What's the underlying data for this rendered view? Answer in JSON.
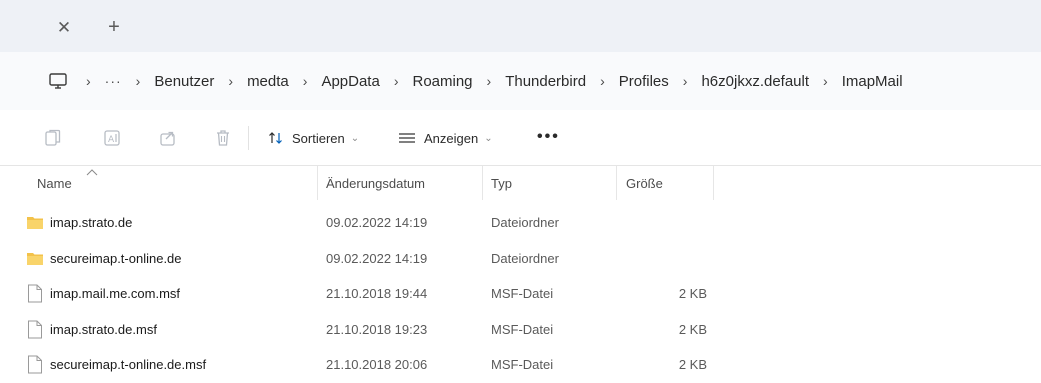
{
  "tabbar": {
    "close_glyph": "✕",
    "new_tab_glyph": "+"
  },
  "address": {
    "overflow": "···",
    "crumbs": [
      "Benutzer",
      "medta",
      "AppData",
      "Roaming",
      "Thunderbird",
      "Profiles",
      "h6z0jkxz.default",
      "ImapMail"
    ],
    "separator": "›"
  },
  "toolbar": {
    "sort_label": "Sortieren",
    "view_label": "Anzeigen",
    "more": "•••",
    "chevron": "⌄"
  },
  "columns": {
    "name": "Name",
    "date": "Änderungsdatum",
    "type": "Typ",
    "size": "Größe"
  },
  "files": [
    {
      "name": "imap.strato.de",
      "date": "09.02.2022 14:19",
      "type": "Dateiordner",
      "size": "",
      "icon": "folder-icon"
    },
    {
      "name": "secureimap.t-online.de",
      "date": "09.02.2022 14:19",
      "type": "Dateiordner",
      "size": "",
      "icon": "folder-icon"
    },
    {
      "name": "imap.mail.me.com.msf",
      "date": "21.10.2018 19:44",
      "type": "MSF-Datei",
      "size": "2 KB",
      "icon": "file-icon"
    },
    {
      "name": "imap.strato.de.msf",
      "date": "21.10.2018 19:23",
      "type": "MSF-Datei",
      "size": "2 KB",
      "icon": "file-icon"
    },
    {
      "name": "secureimap.t-online.de.msf",
      "date": "21.10.2018 20:06",
      "type": "MSF-Datei",
      "size": "2 KB",
      "icon": "file-icon"
    }
  ],
  "colors": {
    "folder": "#f3c24a",
    "accent": "#005fb8",
    "tabbar_bg": "#eef1f6"
  }
}
